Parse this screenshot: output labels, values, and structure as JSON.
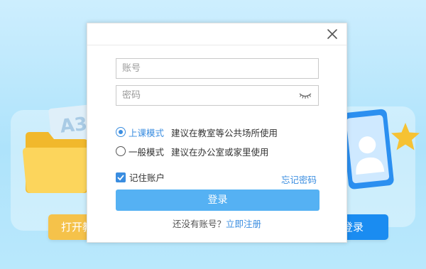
{
  "background": {
    "paper_text": "A3",
    "open_button_label": "打开教",
    "login_button_label": "登录"
  },
  "dialog": {
    "account": {
      "placeholder": "账号",
      "value": ""
    },
    "password": {
      "placeholder": "密码",
      "value": ""
    },
    "modes": [
      {
        "label": "上课模式",
        "description": "建议在教室等公共场所使用",
        "selected": true
      },
      {
        "label": "一般模式",
        "description": "建议在办公室或家里使用",
        "selected": false
      }
    ],
    "remember_label": "记住账户",
    "remember_checked": true,
    "forgot_label": "忘记密码",
    "login_label": "登录",
    "no_account_text": "还没有账号？",
    "register_label": "立即注册"
  },
  "colors": {
    "accent": "#3a8de0",
    "login_button": "#55b1f3",
    "bg_open_button": "#f5c24a",
    "bg_login_button": "#1a8cf1"
  },
  "icons": {
    "close": "close-icon",
    "eye": "eye-closed-icon",
    "check": "checkmark-icon",
    "folder": "folder-icon",
    "avatar": "user-avatar-icon",
    "star": "star-icon"
  }
}
